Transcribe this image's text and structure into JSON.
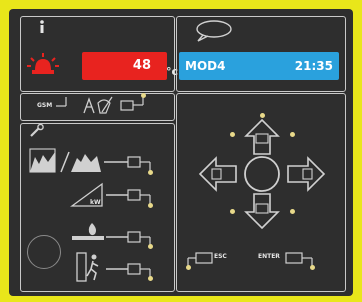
{
  "temperature": {
    "value": "48",
    "unit": "°c"
  },
  "mode": {
    "name": "MOD4",
    "time": "21:35"
  },
  "hold_label": "GSM",
  "slope_label": "kW",
  "nav": {
    "esc_label": "ESC",
    "enter_label": "ENTER"
  },
  "colors": {
    "panel": "#2e2e2e",
    "background": "#e9e61a",
    "temp_bg": "#e8231f",
    "mode_bg": "#2aa1dd",
    "indicator": "#e8d98a"
  }
}
